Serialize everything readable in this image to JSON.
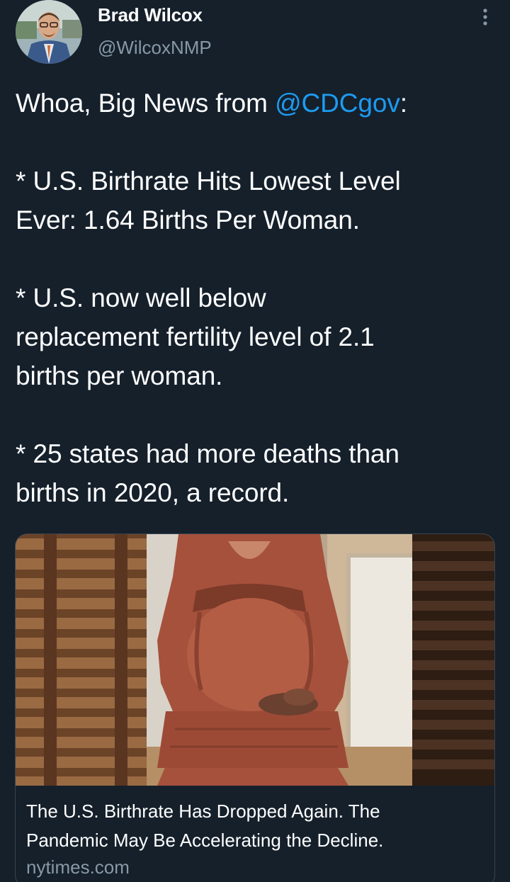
{
  "author": {
    "name": "Brad Wilcox",
    "handle": "@WilcoxNMP",
    "avatar_icon": "profile-photo"
  },
  "more_icon": "more-vertical-icon",
  "tweet": {
    "intro_prefix": "Whoa, Big News from ",
    "mention": "@CDCgov",
    "intro_suffix": ":",
    "bullet1_line1": "* U.S. Birthrate Hits Lowest Level",
    "bullet1_line2": "Ever: 1.64 Births Per Woman.",
    "bullet2_line1": "* U.S. now well below",
    "bullet2_line2": "replacement fertility level of 2.1",
    "bullet2_line3": "births per woman.",
    "bullet3_line1": "* 25 states had more deaths than",
    "bullet3_line2": "births in 2020, a record."
  },
  "card": {
    "title_line1": "The U.S. Birthrate Has Dropped Again. The",
    "title_line2": "Pandemic May Be Accelerating the Decline.",
    "domain": "nytimes.com",
    "image_icon": "article-photo"
  },
  "colors": {
    "background": "#15202b",
    "text": "#ffffff",
    "secondary_text": "#8899a6",
    "link": "#1d9bf0",
    "border": "#38444d"
  }
}
